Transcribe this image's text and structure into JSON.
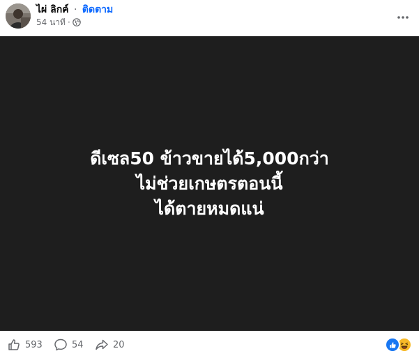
{
  "header": {
    "author": "ไผ่ ลิกค์",
    "separator": "·",
    "follow_label": "ติดตาม",
    "time": "54 นาที",
    "meta_separator": "·",
    "privacy_icon": "globe-icon",
    "more_icon": "more-horizontal-icon"
  },
  "media": {
    "background": "#1e1e1e",
    "lines": [
      "ดีเซล50 ข้าวขายได้5,000กว่า",
      "ไม่ช่วยเกษตรตอนนี้",
      "ได้ตายหมดแน่"
    ]
  },
  "footer": {
    "likes": "593",
    "comments": "54",
    "shares": "20",
    "like_icon": "thumbs-up-icon",
    "comment_icon": "comment-icon",
    "share_icon": "share-icon",
    "reactions": [
      "like-reaction-icon",
      "haha-reaction-icon"
    ]
  },
  "colors": {
    "accent": "#0866ff",
    "secondary_text": "#65676b",
    "media_bg": "#1e1e1e",
    "like_reaction": "#1877f2",
    "haha_reaction": "#f7b928"
  }
}
